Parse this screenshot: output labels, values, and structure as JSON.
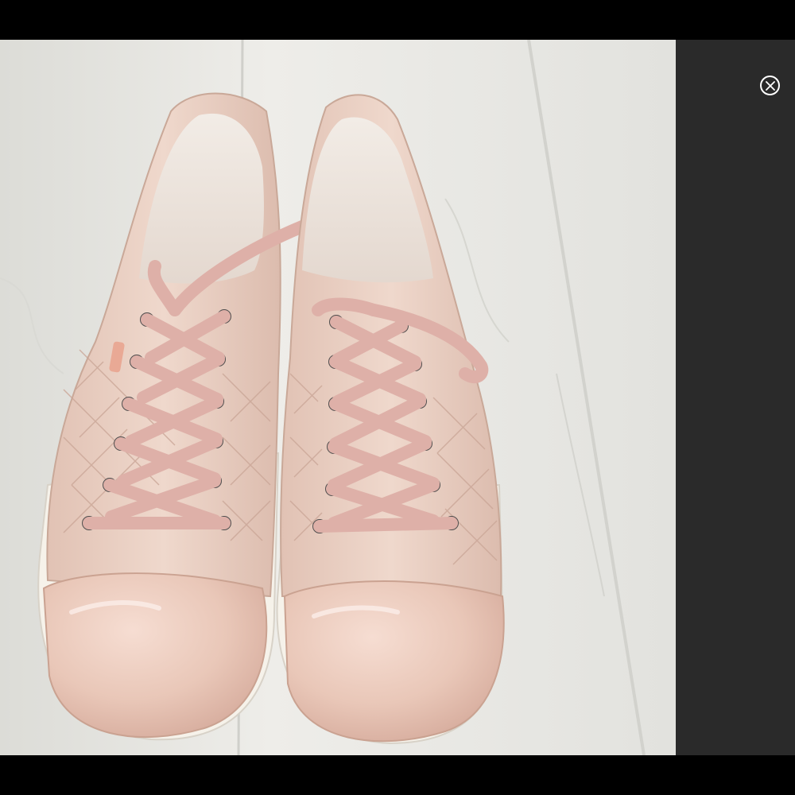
{
  "viewer": {
    "photo_subject": "pair-of-pink-quilted-sneakers",
    "close_icon": "close-circle-icon",
    "colors": {
      "backdrop": "#000000",
      "side_panel": "#2a2a2a",
      "floor": "#e9e8e4",
      "shoe_leather": "#e8cdbf",
      "shoe_patent_toe": "#eccbbd",
      "laces": "#deb0a8",
      "sole": "#f6f2ea",
      "eyelet": "#6b6b6b"
    }
  }
}
